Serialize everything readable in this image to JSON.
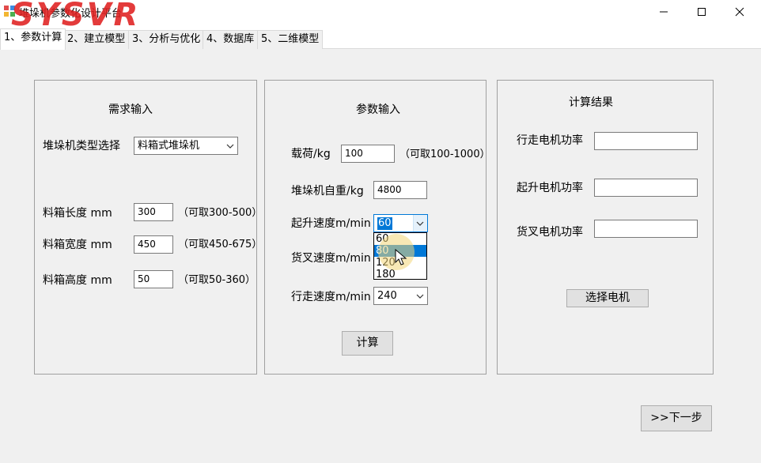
{
  "window": {
    "title": "堆垛机参数化设计平台",
    "brand": "SYSVR",
    "icon_name": "app-icon",
    "controls": [
      "minimize-icon",
      "maximize-icon",
      "close-icon"
    ]
  },
  "tabs": [
    {
      "label": "1、参数计算",
      "active": true
    },
    {
      "label": "2、建立模型",
      "active": false
    },
    {
      "label": "3、分析与优化",
      "active": false
    },
    {
      "label": "4、数据库",
      "active": false
    },
    {
      "label": "5、二维模型",
      "active": false
    }
  ],
  "demand": {
    "title": "需求输入",
    "type_label": "堆垛机类型选择",
    "type_value": "料箱式堆垛机",
    "length_label": "料箱长度 mm",
    "length_value": "300",
    "length_hint": "（可取300-500）",
    "width_label": "料箱宽度 mm",
    "width_value": "450",
    "width_hint": "（可取450-675）",
    "height_label": "料箱高度 mm",
    "height_value": "50",
    "height_hint": "（可取50-360）"
  },
  "params": {
    "title": "参数输入",
    "load_label": "载荷/kg",
    "load_value": "100",
    "load_hint": "（可取100-1000）",
    "weight_label": "堆垛机自重/kg",
    "weight_value": "4800",
    "lift_label": "起升速度m/min",
    "lift_value": "60",
    "lift_options": [
      "60",
      "80",
      "120",
      "180"
    ],
    "lift_highlighted": "80",
    "fork_label": "货叉速度m/min",
    "travel_label": "行走速度m/min",
    "travel_value": "240",
    "calc_button": "计算"
  },
  "results": {
    "title": "计算结果",
    "travel_power_label": "行走电机功率",
    "travel_power_value": "",
    "lift_power_label": "起升电机功率",
    "lift_power_value": "",
    "fork_power_label": "货叉电机功率",
    "fork_power_value": "",
    "select_button": "选择电机"
  },
  "next_button": ">>下一步",
  "colors": {
    "brand": "#e02020",
    "panel": "#f0f0f0",
    "selection": "#0078d7",
    "button": "#e1e1e1"
  }
}
